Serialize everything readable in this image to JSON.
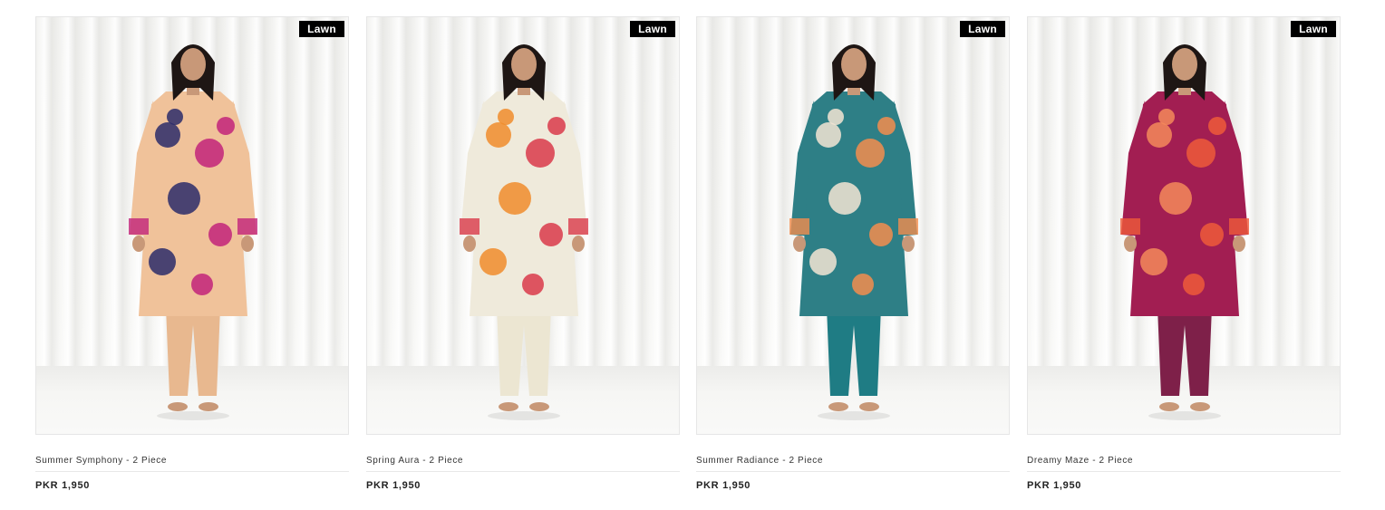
{
  "products": [
    {
      "name": "Summer Symphony - 2 Piece",
      "price": "PKR 1,950",
      "badge": "Lawn",
      "palette": {
        "shirt": "#f0c29a",
        "accent": "#c2237a",
        "accent2": "#2b2b6a",
        "trouser": "#e8b88f"
      }
    },
    {
      "name": "Spring Aura - 2 Piece",
      "price": "PKR 1,950",
      "badge": "Lawn",
      "palette": {
        "shirt": "#efeadb",
        "accent": "#d93a4a",
        "accent2": "#f08c2c",
        "trouser": "#ece6d2"
      }
    },
    {
      "name": "Summer Radiance - 2 Piece",
      "price": "PKR 1,950",
      "badge": "Lawn",
      "palette": {
        "shirt": "#2e7f86",
        "accent": "#f38d4e",
        "accent2": "#f3e5d3",
        "trouser": "#1f7c84"
      }
    },
    {
      "name": "Dreamy Maze - 2 Piece",
      "price": "PKR 1,950",
      "badge": "Lawn",
      "palette": {
        "shirt": "#a21e52",
        "accent": "#ef5a3a",
        "accent2": "#f58a5a",
        "trouser": "#7e2049"
      }
    }
  ]
}
